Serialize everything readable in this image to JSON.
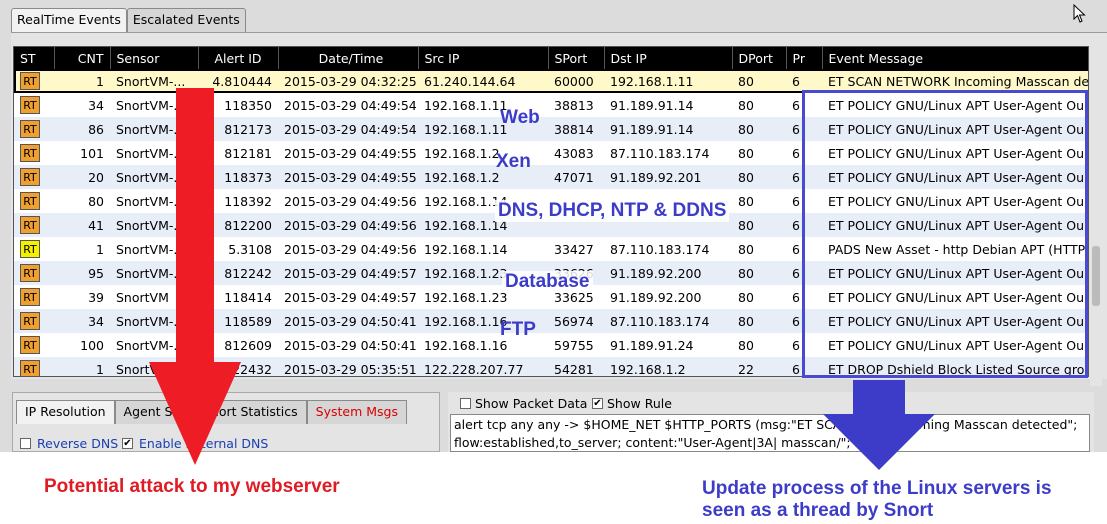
{
  "tabs_top": [
    "RealTime Events",
    "Escalated Events"
  ],
  "columns": [
    "ST",
    "CNT",
    "Sensor",
    "Alert ID",
    "Date/Time",
    "Src IP",
    "SPort",
    "Dst IP",
    "DPort",
    "Pr",
    "Event Message"
  ],
  "rows": [
    {
      "st": "RT",
      "st_color": "#f0a030",
      "cnt": "1",
      "sensor": "SnortVM-...",
      "alert_id": "4.810444",
      "datetime": "2015-03-29 04:32:25",
      "src_ip": "61.240.144.64",
      "sport": "60000",
      "dst_ip": "192.168.1.11",
      "dport": "80",
      "pr": "6",
      "msg": "ET SCAN NETWORK Incoming Masscan de..."
    },
    {
      "st": "RT",
      "st_color": "#f0a030",
      "cnt": "34",
      "sensor": "SnortVM-...",
      "alert_id": "118350",
      "datetime": "2015-03-29 04:49:54",
      "src_ip": "192.168.1.11",
      "sport": "38813",
      "dst_ip": "91.189.91.14",
      "dport": "80",
      "pr": "6",
      "msg": "ET POLICY GNU/Linux APT User-Agent Ou..."
    },
    {
      "st": "RT",
      "st_color": "#f0a030",
      "cnt": "86",
      "sensor": "SnortVM-...",
      "alert_id": "812173",
      "datetime": "2015-03-29 04:49:54",
      "src_ip": "192.168.1.11",
      "sport": "38814",
      "dst_ip": "91.189.91.14",
      "dport": "80",
      "pr": "6",
      "msg": "ET POLICY GNU/Linux APT User-Agent Ou..."
    },
    {
      "st": "RT",
      "st_color": "#f0a030",
      "cnt": "101",
      "sensor": "SnortVM-...",
      "alert_id": "812181",
      "datetime": "2015-03-29 04:49:55",
      "src_ip": "192.168.1.2",
      "sport": "43083",
      "dst_ip": "87.110.183.174",
      "dport": "80",
      "pr": "6",
      "msg": "ET POLICY GNU/Linux APT User-Agent Ou..."
    },
    {
      "st": "RT",
      "st_color": "#f0a030",
      "cnt": "20",
      "sensor": "SnortVM-...",
      "alert_id": "118373",
      "datetime": "2015-03-29 04:49:55",
      "src_ip": "192.168.1.2",
      "sport": "47071",
      "dst_ip": "91.189.92.201",
      "dport": "80",
      "pr": "6",
      "msg": "ET POLICY GNU/Linux APT User-Agent Ou..."
    },
    {
      "st": "RT",
      "st_color": "#f0a030",
      "cnt": "80",
      "sensor": "SnortVM-...",
      "alert_id": "118392",
      "datetime": "2015-03-29 04:49:56",
      "src_ip": "192.168.1.14",
      "sport": "",
      "dst_ip": "",
      "dport": "80",
      "pr": "6",
      "msg": "ET POLICY GNU/Linux APT User-Agent Ou..."
    },
    {
      "st": "RT",
      "st_color": "#f0a030",
      "cnt": "41",
      "sensor": "SnortVM-...",
      "alert_id": "812200",
      "datetime": "2015-03-29 04:49:56",
      "src_ip": "192.168.1.14",
      "sport": "",
      "dst_ip": "",
      "dport": "80",
      "pr": "6",
      "msg": "ET POLICY GNU/Linux APT User-Agent Ou..."
    },
    {
      "st": "RT",
      "st_color": "#f5f000",
      "cnt": "1",
      "sensor": "SnortVM-...",
      "alert_id": "5.3108",
      "datetime": "2015-03-29 04:49:56",
      "src_ip": "192.168.1.14",
      "sport": "33427",
      "dst_ip": "87.110.183.174",
      "dport": "80",
      "pr": "6",
      "msg": "PADS New Asset - http Debian APT (HTTP/..."
    },
    {
      "st": "RT",
      "st_color": "#f0a030",
      "cnt": "95",
      "sensor": "SnortVM-...",
      "alert_id": "812242",
      "datetime": "2015-03-29 04:49:57",
      "src_ip": "192.168.1.23",
      "sport": "33626",
      "dst_ip": "91.189.92.200",
      "dport": "80",
      "pr": "6",
      "msg": "ET POLICY GNU/Linux APT User-Agent Ou..."
    },
    {
      "st": "RT",
      "st_color": "#f0a030",
      "cnt": "39",
      "sensor": "SnortVM",
      "alert_id": "118414",
      "datetime": "2015-03-29 04:49:57",
      "src_ip": "192.168.1.23",
      "sport": "33625",
      "dst_ip": "91.189.92.200",
      "dport": "80",
      "pr": "6",
      "msg": "ET POLICY GNU/Linux APT User-Agent Ou..."
    },
    {
      "st": "RT",
      "st_color": "#f0a030",
      "cnt": "34",
      "sensor": "SnortVM-...",
      "alert_id": "118589",
      "datetime": "2015-03-29 04:50:41",
      "src_ip": "192.168.1.16",
      "sport": "56974",
      "dst_ip": "87.110.183.174",
      "dport": "80",
      "pr": "6",
      "msg": "ET POLICY GNU/Linux APT User-Agent Ou..."
    },
    {
      "st": "RT",
      "st_color": "#f0a030",
      "cnt": "100",
      "sensor": "SnortVM-...",
      "alert_id": "812609",
      "datetime": "2015-03-29 04:50:41",
      "src_ip": "192.168.1.16",
      "sport": "59755",
      "dst_ip": "91.189.91.24",
      "dport": "80",
      "pr": "6",
      "msg": "ET POLICY GNU/Linux APT User-Agent Ou..."
    },
    {
      "st": "RT",
      "st_color": "#f0a030",
      "cnt": "1",
      "sensor": "SnortVM-...",
      "alert_id": "122432",
      "datetime": "2015-03-29 05:35:51",
      "src_ip": "122.228.207.77",
      "sport": "54281",
      "dst_ip": "192.168.1.2",
      "dport": "22",
      "pr": "6",
      "msg": "ET DROP Dshield Block Listed Source grou..."
    }
  ],
  "tabs_lower": [
    "IP Resolution",
    "Agent Sta",
    "Snort Statistics",
    "System Msgs"
  ],
  "options_lower": {
    "reverse_dns": "Reverse DNS",
    "enable_external_dns": "Enable External DNS"
  },
  "options_right": {
    "show_packet_data": "Show Packet Data",
    "show_rule": "Show Rule"
  },
  "rule_text": {
    "line1": "alert tcp any any -> $HOME_NET $HTTP_PORTS (msg:\"ET SCAN NETW           ncoming Masscan detected\";",
    "line2": "flow:established,to_server; content:\"User-Agent|3A| masscan/\"; ht"
  },
  "annotations": {
    "web": "Web",
    "xen": "Xen",
    "dns": "DNS, DHCP, NTP & DDNS",
    "database": "Database",
    "ftp": "FTP",
    "left_caption": "Potential attack to my webserver",
    "right_caption_1": "Update process of the Linux servers is",
    "right_caption_2": "seen as a thread by Snort",
    "red": "#e01b24",
    "blue": "#3c3cc8"
  }
}
